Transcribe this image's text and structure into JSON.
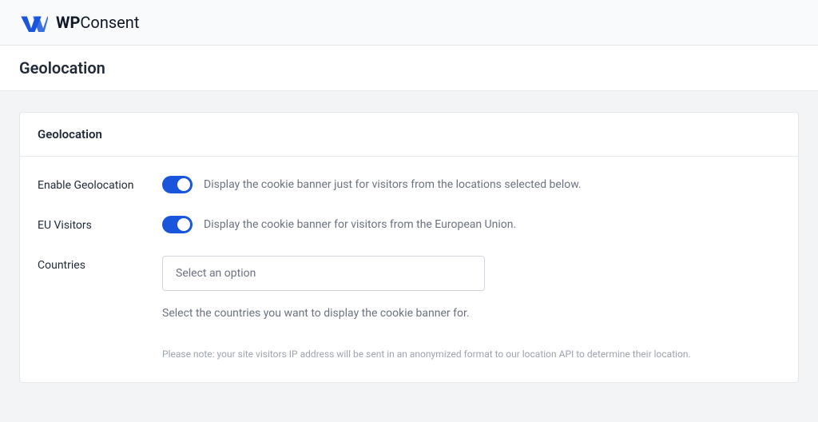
{
  "brand": {
    "prefix": "WP",
    "suffix": "Consent"
  },
  "page": {
    "title": "Geolocation"
  },
  "card": {
    "title": "Geolocation"
  },
  "fields": {
    "enable_geolocation": {
      "label": "Enable Geolocation",
      "description": "Display the cookie banner just for visitors from the locations selected below."
    },
    "eu_visitors": {
      "label": "EU Visitors",
      "description": "Display the cookie banner for visitors from the European Union."
    },
    "countries": {
      "label": "Countries",
      "placeholder": "Select an option",
      "helper": "Select the countries you want to display the cookie banner for.",
      "note": "Please note: your site visitors IP address will be sent in an anonymized format to our location API to determine their location."
    }
  }
}
